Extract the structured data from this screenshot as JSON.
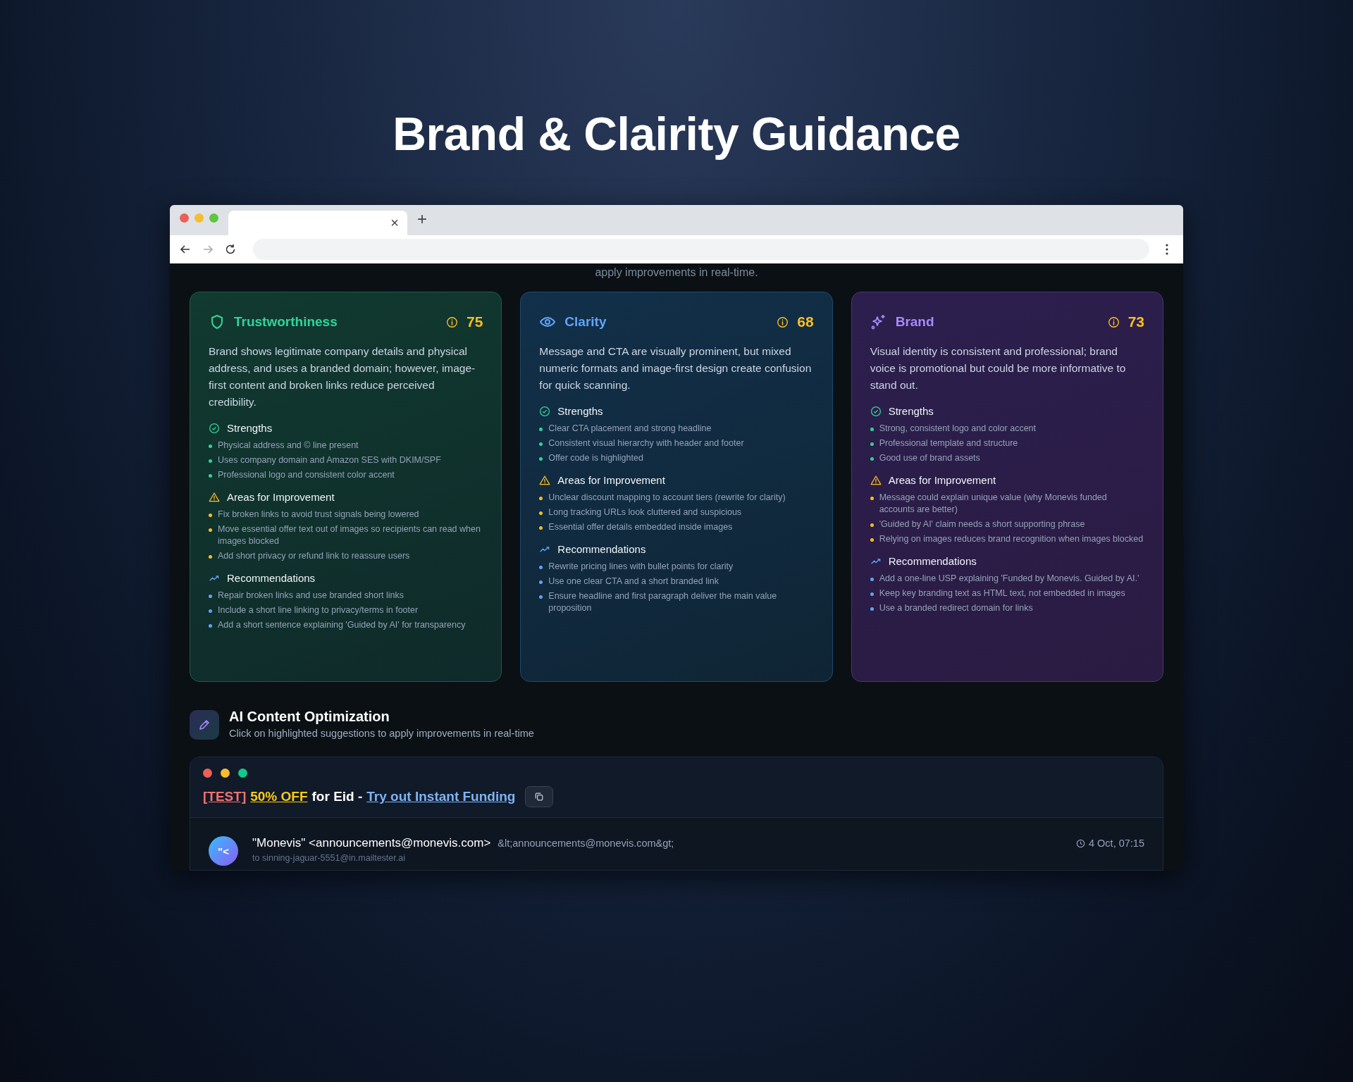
{
  "page_title": "Brand & Clairity Guidance",
  "browser": {
    "tab_close": "×",
    "new_tab": "+"
  },
  "intro_tail": "apply improvements in real-time.",
  "cards": [
    {
      "kind": "shield",
      "title": "Trustworthiness",
      "color": "#34d399",
      "score": "75",
      "summary": "Brand shows legitimate company details and physical address, and uses a branded domain; however, image-first content and broken links reduce perceived credibility.",
      "sections": [
        {
          "kind": "strengths",
          "title": "Strengths",
          "items": [
            "Physical address and © line present",
            "Uses company domain and Amazon SES with DKIM/SPF",
            "Professional logo and consistent color accent"
          ]
        },
        {
          "kind": "improvements",
          "title": "Areas for Improvement",
          "items": [
            "Fix broken links to avoid trust signals being lowered",
            "Move essential offer text out of images so recipients can read when images blocked",
            "Add short privacy or refund link to reassure users"
          ]
        },
        {
          "kind": "recommendations",
          "title": "Recommendations",
          "items": [
            "Repair broken links and use branded short links",
            "Include a short line linking to privacy/terms in footer",
            "Add a short sentence explaining 'Guided by AI' for transparency"
          ]
        }
      ]
    },
    {
      "kind": "eye",
      "title": "Clarity",
      "color": "#60a5fa",
      "score": "68",
      "summary": "Message and CTA are visually prominent, but mixed numeric formats and image-first design create confusion for quick scanning.",
      "sections": [
        {
          "kind": "strengths",
          "title": "Strengths",
          "items": [
            "Clear CTA placement and strong headline",
            "Consistent visual hierarchy with header and footer",
            "Offer code is highlighted"
          ]
        },
        {
          "kind": "improvements",
          "title": "Areas for Improvement",
          "items": [
            "Unclear discount mapping to account tiers (rewrite for clarity)",
            "Long tracking URLs look cluttered and suspicious",
            "Essential offer details embedded inside images"
          ]
        },
        {
          "kind": "recommendations",
          "title": "Recommendations",
          "items": [
            "Rewrite pricing lines with bullet points for clarity",
            "Use one clear CTA and a short branded link",
            "Ensure headline and first paragraph deliver the main value proposition"
          ]
        }
      ]
    },
    {
      "kind": "sparkle",
      "title": "Brand",
      "color": "#a78bfa",
      "score": "73",
      "summary": "Visual identity is consistent and professional; brand voice is promotional but could be more informative to stand out.",
      "sections": [
        {
          "kind": "strengths",
          "title": "Strengths",
          "items": [
            "Strong, consistent logo and color accent",
            "Professional template and structure",
            "Good use of brand assets"
          ]
        },
        {
          "kind": "improvements",
          "title": "Areas for Improvement",
          "items": [
            "Message could explain unique value (why Monevis funded accounts are better)",
            "'Guided by AI' claim needs a short supporting phrase",
            "Relying on images reduces brand recognition when images blocked"
          ]
        },
        {
          "kind": "recommendations",
          "title": "Recommendations",
          "items": [
            "Add a one-line USP explaining 'Funded by Monevis. Guided by AI.'",
            "Keep key branding text as HTML text, not embedded in images",
            "Use a branded redirect domain for links"
          ]
        }
      ]
    }
  ],
  "optimization": {
    "title": "AI Content Optimization",
    "subtitle": "Click on highlighted suggestions to apply improvements in real-time"
  },
  "email": {
    "subject": [
      {
        "kind": "tag",
        "text": "[TEST]"
      },
      {
        "kind": "highlight",
        "text": "50% OFF"
      },
      {
        "kind": "plain",
        "text": "for Eid -"
      },
      {
        "kind": "link",
        "text": "Try out Instant Funding"
      }
    ],
    "avatar": "\"<",
    "sender": "\"Monevis\" <announcements@monevis.com>",
    "address": "&lt;announcements@monevis.com&gt;",
    "time": "4 Oct, 07:15",
    "to": "to sinning-jaguar-5551@in.mailtester.ai"
  }
}
